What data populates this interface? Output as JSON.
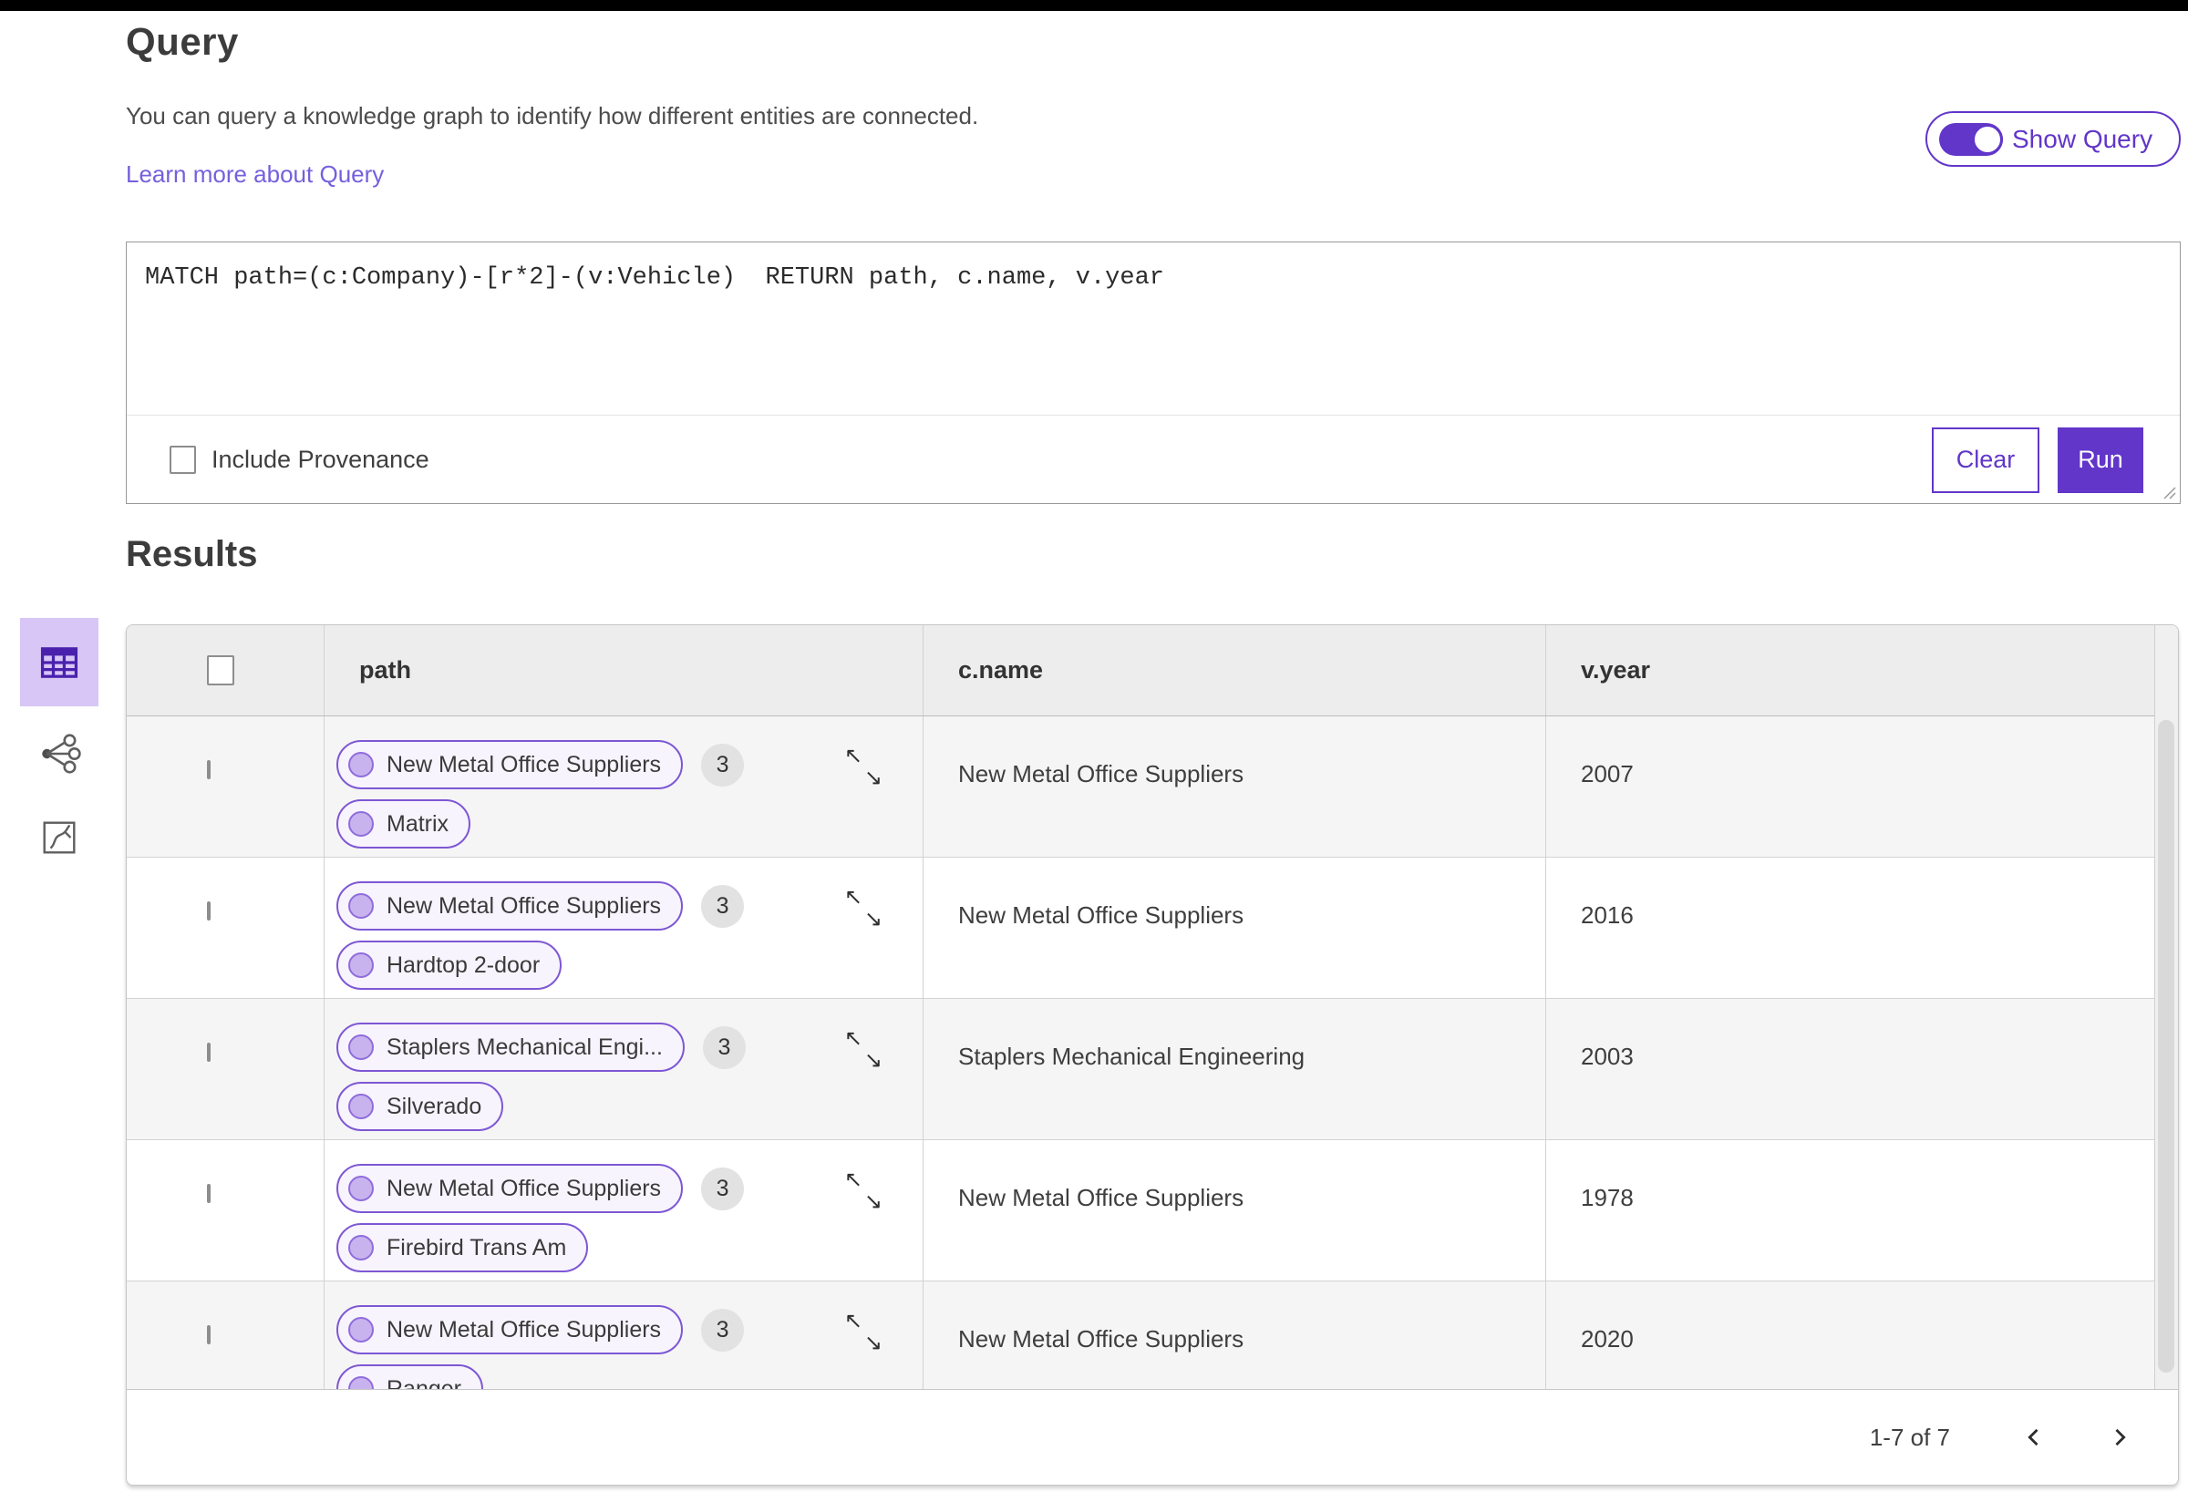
{
  "header": {
    "title": "Query",
    "description": "You can query a knowledge graph to identify how different entities are connected.",
    "learn_more_link": "Learn more about Query",
    "show_query_toggle": {
      "label": "Show Query",
      "state": "on"
    }
  },
  "query_editor": {
    "query_text": "MATCH path=(c:Company)-[r*2]-(v:Vehicle)  RETURN path, c.name, v.year",
    "include_provenance_label": "Include Provenance",
    "include_provenance_checked": false,
    "clear_button": "Clear",
    "run_button": "Run"
  },
  "results": {
    "heading": "Results",
    "view_switcher": [
      {
        "name": "table-view",
        "selected": true
      },
      {
        "name": "graph-view",
        "selected": false
      },
      {
        "name": "chart-view",
        "selected": false
      }
    ],
    "table": {
      "columns": [
        "path",
        "c.name",
        "v.year"
      ],
      "rows": [
        {
          "path_nodes": [
            "New Metal Office Suppliers",
            "Matrix"
          ],
          "path_count": "3",
          "c_name": "New Metal Office Suppliers",
          "v_year": "2007"
        },
        {
          "path_nodes": [
            "New Metal Office Suppliers",
            "Hardtop 2-door"
          ],
          "path_count": "3",
          "c_name": "New Metal Office Suppliers",
          "v_year": "2016"
        },
        {
          "path_nodes": [
            "Staplers Mechanical Engi...",
            "Silverado"
          ],
          "path_count": "3",
          "c_name": "Staplers Mechanical Engineering",
          "v_year": "2003"
        },
        {
          "path_nodes": [
            "New Metal Office Suppliers",
            "Firebird Trans Am"
          ],
          "path_count": "3",
          "c_name": "New Metal Office Suppliers",
          "v_year": "1978"
        },
        {
          "path_nodes": [
            "New Metal Office Suppliers",
            "Ranger"
          ],
          "path_count": "3",
          "c_name": "New Metal Office Suppliers",
          "v_year": "2020"
        }
      ]
    },
    "pagination": {
      "range_text": "1-7 of 7"
    }
  },
  "icons": {
    "expand_nw": "↖",
    "expand_se": "↘",
    "prev_page": "chevron-left",
    "next_page": "chevron-right"
  },
  "colors": {
    "accent": "#6136c9",
    "accent_light_bg": "#d8c6f6",
    "pill_border": "#7e57d4",
    "pill_bg": "#f7f4fd",
    "node_circle_fill": "#c9b3ee",
    "node_circle_border": "#8f6ddd",
    "link": "#7460dd",
    "row_alt_bg": "#f5f5f5",
    "header_bg": "#ededed",
    "badge_bg": "#e2e2e2"
  }
}
